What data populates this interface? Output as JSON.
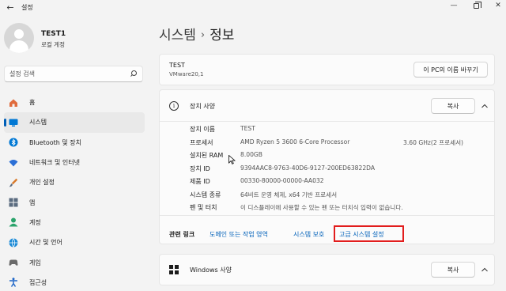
{
  "window": {
    "title": "설정",
    "back_icon": "arrow-left-icon"
  },
  "user": {
    "name": "TEST1",
    "account_type": "로컬 계정"
  },
  "search": {
    "placeholder": "설정 검색"
  },
  "sidebar": {
    "items": [
      {
        "label": "홈",
        "icon": "home-icon",
        "color": "#e06b3c"
      },
      {
        "label": "시스템",
        "icon": "system-icon",
        "color": "#0078d4",
        "active": true
      },
      {
        "label": "Bluetooth 및 장치",
        "icon": "bluetooth-icon",
        "color": "#0078d4"
      },
      {
        "label": "네트워크 및 인터넷",
        "icon": "network-icon",
        "color": "#2b6fd6"
      },
      {
        "label": "개인 설정",
        "icon": "brush-icon",
        "color": "#d87a2a"
      },
      {
        "label": "앱",
        "icon": "apps-icon",
        "color": "#5a6b7f"
      },
      {
        "label": "계정",
        "icon": "account-icon",
        "color": "#2aa36b"
      },
      {
        "label": "시간 및 언어",
        "icon": "globe-icon",
        "color": "#1c8ad6"
      },
      {
        "label": "게임",
        "icon": "gaming-icon",
        "color": "#6a6a6a"
      },
      {
        "label": "접근성",
        "icon": "accessibility-icon",
        "color": "#1e66c7"
      }
    ]
  },
  "breadcrumb": {
    "parent": "시스템",
    "separator": "›",
    "current": "정보"
  },
  "pc_card": {
    "name": "TEST",
    "model": "VMware20,1",
    "rename_button": "이 PC의 이름 바꾸기"
  },
  "device_specs": {
    "title": "장치 사양",
    "copy_button": "복사",
    "rows": [
      {
        "key": "장치 이름",
        "value": "TEST"
      },
      {
        "key": "프로세서",
        "value": "AMD Ryzen 5 3600 6-Core Processor",
        "extra": "3.60 GHz(2 프로세서)"
      },
      {
        "key": "설치된 RAM",
        "value": "8.00GB"
      },
      {
        "key": "장치 ID",
        "value": "9394AAC8-9763-40D6-9127-200ED63822DA"
      },
      {
        "key": "제품 ID",
        "value": "00330-80000-00000-AA032"
      },
      {
        "key": "시스템 종류",
        "value": "64비트 운영 체제, x64 기반 프로세서"
      },
      {
        "key": "펜 및 터치",
        "value": "이 디스플레이에 사용할 수 있는 펜 또는 터치식 입력이 없습니다."
      }
    ]
  },
  "related_links": {
    "label": "관련 링크",
    "links": [
      "도메인 또는 작업 영역",
      "시스템 보호",
      "고급 시스템 설정"
    ]
  },
  "windows_specs": {
    "title": "Windows 사양",
    "copy_button": "복사"
  },
  "colors": {
    "accent": "#005fb8",
    "link": "#0060b9",
    "highlight": "#e21d1d"
  }
}
